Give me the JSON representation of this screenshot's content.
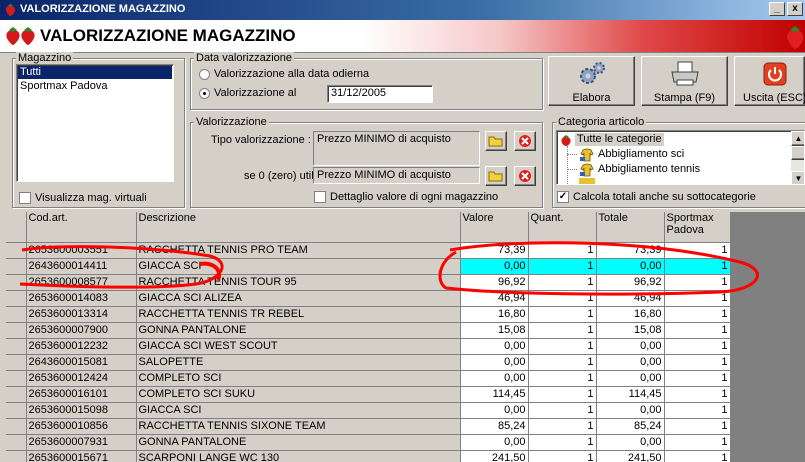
{
  "window": {
    "title": "VALORIZZAZIONE MAGAZZINO",
    "banner_title": "VALORIZZAZIONE MAGAZZINO",
    "minimize": "_",
    "close": "x"
  },
  "magazzino": {
    "label": "Magazzino",
    "items": [
      {
        "label": "Tutti",
        "selected": true
      },
      {
        "label": "Sportmax Padova",
        "selected": false
      }
    ],
    "virtual_checkbox_label": "Visualizza mag. virtuali"
  },
  "data_valorizzazione": {
    "label": "Data valorizzazione",
    "option_today": "Valorizzazione alla data odierna",
    "option_date": "Valorizzazione al",
    "date_value": "31/12/2005"
  },
  "valorizzazione": {
    "label": "Valorizzazione",
    "tipo_label": "Tipo valorizzazione :",
    "tipo_value": "Prezzo MINIMO di acquisto",
    "zero_label": "se 0 (zero) utilizza :",
    "zero_value": "Prezzo MINIMO di acquisto",
    "dettaglio_label": "Dettaglio valore di ogni magazzino"
  },
  "toolbar": {
    "elabora": "Elabora",
    "stampa": "Stampa (F9)",
    "uscita": "Uscita (ESC)"
  },
  "categoria": {
    "label": "Categoria articolo",
    "items": [
      "Tutte le categorie",
      "Abbigliamento sci",
      "Abbigliamento tennis"
    ],
    "calcola_label": "Calcola totali anche su sottocategorie"
  },
  "grid": {
    "headers": [
      "Cod.art.",
      "Descrizione",
      "Valore",
      "Quant.",
      "Totale",
      "Sportmax Padova"
    ],
    "rows": [
      [
        "2653600003551",
        "RACCHETTA TENNIS PRO TEAM",
        "73,39",
        "1",
        "73,39",
        "1"
      ],
      [
        "2643600014411",
        "GIACCA SCI",
        "0,00",
        "1",
        "0,00",
        "1"
      ],
      [
        "2653600008577",
        "RACCHETTA TENNIS TOUR 95",
        "96,92",
        "1",
        "96,92",
        "1"
      ],
      [
        "2653600014083",
        "GIACCA SCI ALIZEA",
        "46,94",
        "1",
        "46,94",
        "1"
      ],
      [
        "2653600013314",
        "RACCHETTA TENNIS TR REBEL",
        "16,80",
        "1",
        "16,80",
        "1"
      ],
      [
        "2653600007900",
        "GONNA PANTALONE",
        "15,08",
        "1",
        "15,08",
        "1"
      ],
      [
        "2653600012232",
        "GIACCA SCI WEST SCOUT",
        "0,00",
        "1",
        "0,00",
        "1"
      ],
      [
        "2643600015081",
        "SALOPETTE",
        "0,00",
        "1",
        "0,00",
        "1"
      ],
      [
        "2653600012424",
        "COMPLETO SCI",
        "0,00",
        "1",
        "0,00",
        "1"
      ],
      [
        "2653600016101",
        "COMPLETO SCI SUKU",
        "114,45",
        "1",
        "114,45",
        "1"
      ],
      [
        "2653600015098",
        "GIACCA SCI",
        "0,00",
        "1",
        "0,00",
        "1"
      ],
      [
        "2653600010856",
        "RACCHETTA TENNIS SIXONE TEAM",
        "85,24",
        "1",
        "85,24",
        "1"
      ],
      [
        "2653600007931",
        "GONNA PANTALONE",
        "0,00",
        "1",
        "0,00",
        "1"
      ],
      [
        "2653600015671",
        "SCARPONI LANGE WC 130",
        "241,50",
        "1",
        "241,50",
        "1"
      ]
    ],
    "selected_row": 1
  },
  "colors": {
    "selection": "#00ffff",
    "title_bar": "#0a246a",
    "annotation": "#ff0000"
  }
}
